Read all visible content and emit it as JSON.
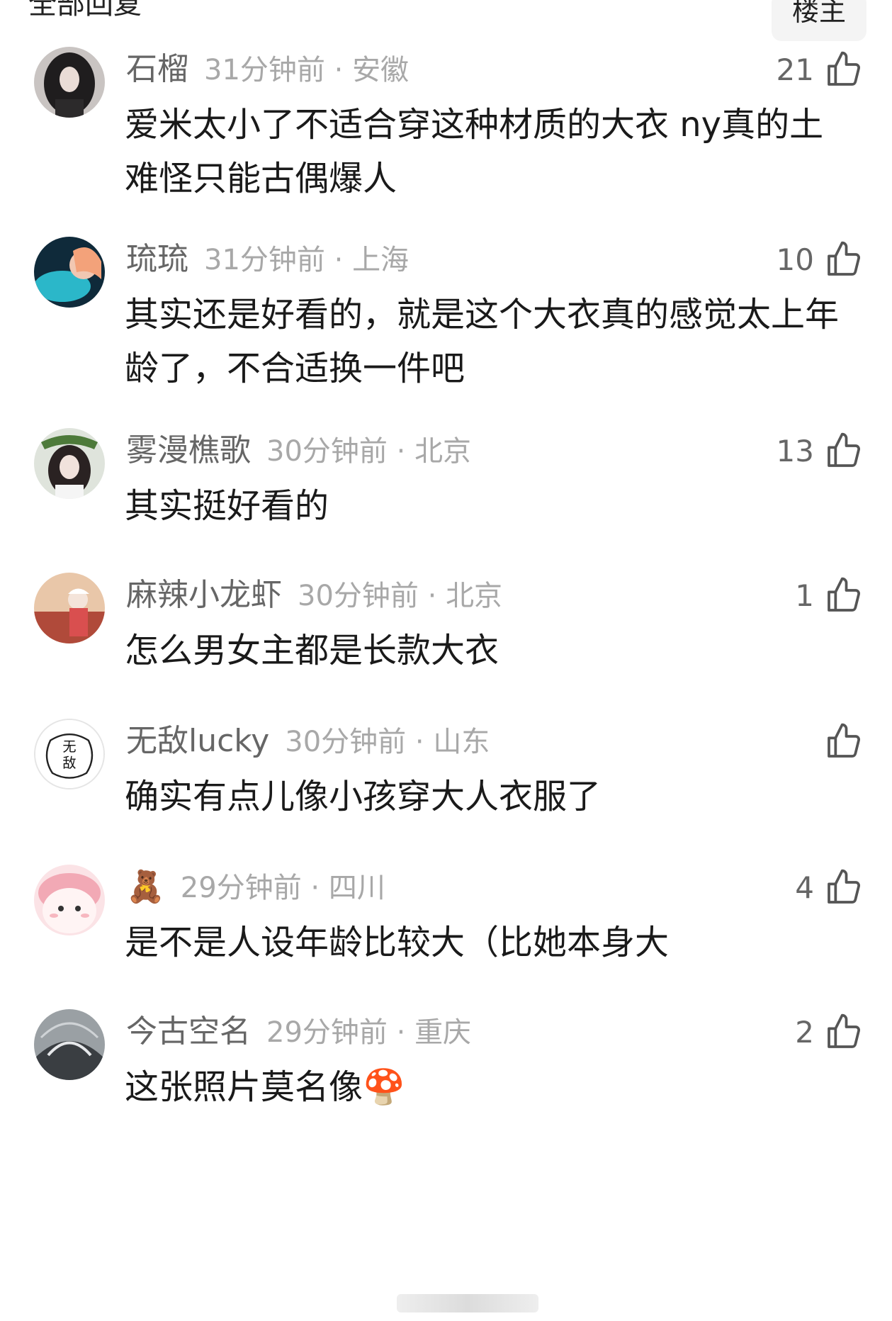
{
  "header": {
    "all_replies": "全部回复",
    "sort_label": "楼主"
  },
  "comments": [
    {
      "name": "石榴",
      "time": "31分钟前",
      "location": "安徽",
      "likes": "21",
      "text": "爱米太小了不适合穿这种材质的大衣 ny真的土 难怪只能古偶爆人"
    },
    {
      "name": "琉琉",
      "time": "31分钟前",
      "location": "上海",
      "likes": "10",
      "text": "其实还是好看的，就是这个大衣真的感觉太上年龄了，不合适换一件吧"
    },
    {
      "name": "雾漫樵歌",
      "time": "30分钟前",
      "location": "北京",
      "likes": "13",
      "text": "其实挺好看的"
    },
    {
      "name": "麻辣小龙虾",
      "time": "30分钟前",
      "location": "北京",
      "likes": "1",
      "text": "怎么男女主都是长款大衣"
    },
    {
      "name": "无敌lucky",
      "time": "30分钟前",
      "location": "山东",
      "likes": "",
      "avatar_text": "无\n敌",
      "text": "确实有点儿像小孩穿大人衣服了"
    },
    {
      "name": "🧸",
      "time": "29分钟前",
      "location": "四川",
      "likes": "4",
      "text": "是不是人设年龄比较大（比她本身大"
    },
    {
      "name": "今古空名",
      "time": "29分钟前",
      "location": "重庆",
      "likes": "2",
      "text": "这张照片莫名像🍄"
    }
  ],
  "separator": " · ",
  "icons": {
    "like": "thumbs-up-icon"
  },
  "colors": {
    "username": "#666666",
    "meta": "#a8a8a8",
    "text": "#1a1a1a"
  }
}
